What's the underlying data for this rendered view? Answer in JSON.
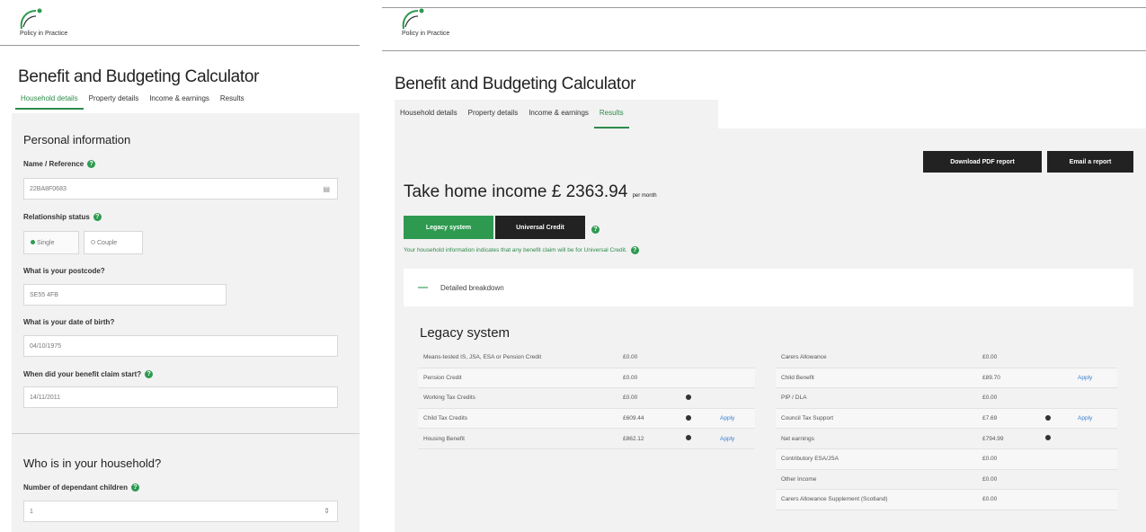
{
  "brand": {
    "logo_text": "Policy in Practice",
    "accent": "#2e9a50",
    "dark_button": "#222222"
  },
  "left": {
    "app_title": "Benefit and Budgeting Calculator",
    "tabs": [
      {
        "label": "Household details",
        "active": true
      },
      {
        "label": "Property details",
        "active": false
      },
      {
        "label": "Income & earnings",
        "active": false
      },
      {
        "label": "Results",
        "active": false
      }
    ],
    "personal": {
      "heading": "Personal information",
      "name_label": "Name / Reference",
      "name_value": "22BA8F0683",
      "relationship_label": "Relationship status",
      "options": [
        "Single",
        "Couple"
      ],
      "selected_option": "Single",
      "postcode_label": "What is your postcode?",
      "postcode_value": "SE55 4FB",
      "dob_label": "What is your date of birth?",
      "dob_value": "04/10/1975",
      "claim_label": "When did your benefit claim start?",
      "claim_value": "14/11/2011"
    },
    "household": {
      "heading": "Who is in your household?",
      "children_label": "Number of dependant children",
      "children_value": "1"
    }
  },
  "right": {
    "app_title": "Benefit and Budgeting Calculator",
    "tabs": [
      {
        "label": "Household details",
        "active": false
      },
      {
        "label": "Property details",
        "active": false
      },
      {
        "label": "Income & earnings",
        "active": false
      },
      {
        "label": "Results",
        "active": true
      }
    ],
    "download_button": "Download PDF report",
    "email_button": "Email a report",
    "takehome_label": "Take home income £ 2363.94",
    "takehome_suffix": "per month",
    "legacy_button": "Legacy system",
    "uc_button": "Universal Credit",
    "uc_note": "Your household information indicates that any benefit claim will be for Universal Credit.",
    "breakdown_label": "Detailed breakdown",
    "legacy_heading": "Legacy system",
    "table_left": [
      {
        "name": "Means-tested IS, JSA, ESA or Pension Credit",
        "value": "£0.00",
        "info": false,
        "apply": ""
      },
      {
        "name": "Pension Credit",
        "value": "£0.00",
        "info": false,
        "apply": ""
      },
      {
        "name": "Working Tax Credits",
        "value": "£0.00",
        "info": true,
        "apply": ""
      },
      {
        "name": "Child Tax Credits",
        "value": "£609.44",
        "info": true,
        "apply": "Apply"
      },
      {
        "name": "Housing Benefit",
        "value": "£862.12",
        "info": true,
        "apply": "Apply"
      }
    ],
    "table_right": [
      {
        "name": "Carers Allowance",
        "value": "£0.00",
        "info": false,
        "apply": ""
      },
      {
        "name": "Child Benefit",
        "value": "£89.70",
        "info": false,
        "apply": "Apply"
      },
      {
        "name": "PIP / DLA",
        "value": "£0.00",
        "info": false,
        "apply": ""
      },
      {
        "name": "Council Tax Support",
        "value": "£7.69",
        "info": true,
        "apply": "Apply"
      },
      {
        "name": "Net earnings",
        "value": "£794.99",
        "info": true,
        "apply": ""
      },
      {
        "name": "Contributory ESA/JSA",
        "value": "£0.00",
        "info": false,
        "apply": ""
      },
      {
        "name": "Other Income",
        "value": "£0.00",
        "info": false,
        "apply": ""
      },
      {
        "name": "Carers Allowance Supplement (Scotland)",
        "value": "£0.00",
        "info": false,
        "apply": ""
      }
    ]
  }
}
